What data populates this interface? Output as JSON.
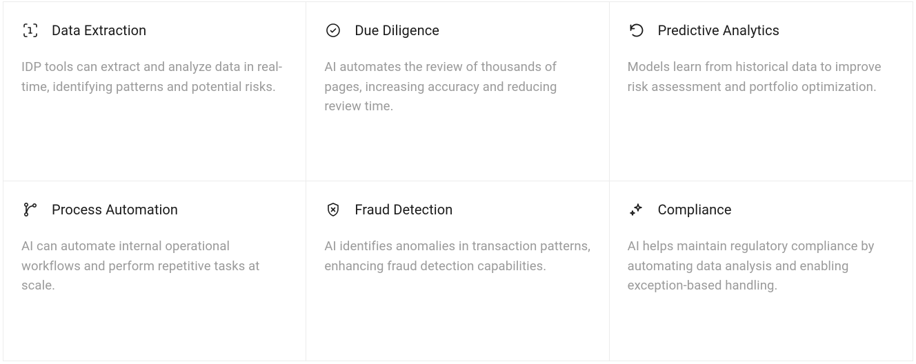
{
  "cards": [
    {
      "icon": "scan-text-icon",
      "title": "Data Extraction",
      "description": "IDP tools can extract and analyze data in real-time, identifying patterns and potential risks."
    },
    {
      "icon": "check-circle-icon",
      "title": "Due Diligence",
      "description": "AI automates the review of thousands of pages, increasing accuracy and reducing review time."
    },
    {
      "icon": "refresh-icon",
      "title": "Predictive Analytics",
      "description": "Models learn from historical data to improve risk assessment and portfolio optimization."
    },
    {
      "icon": "git-branch-icon",
      "title": "Process Automation",
      "description": "AI can automate internal operational workflows and perform repetitive tasks at scale."
    },
    {
      "icon": "shield-x-icon",
      "title": "Fraud Detection",
      "description": "AI identifies anomalies in transaction patterns, enhancing fraud detection capabilities."
    },
    {
      "icon": "sparkles-icon",
      "title": "Compliance",
      "description": "AI helps maintain regulatory compliance by automating data analysis and enabling exception-based handling."
    }
  ]
}
